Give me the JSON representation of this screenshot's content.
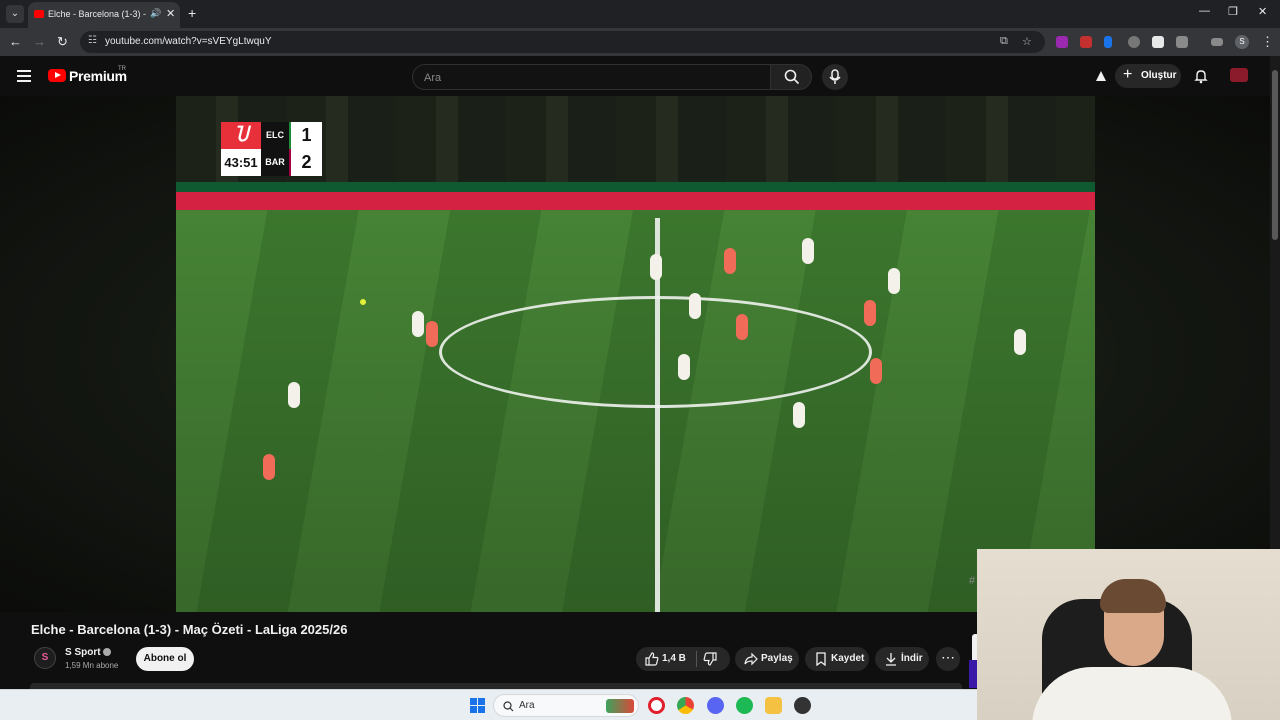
{
  "browser": {
    "tab_title": "Elche - Barcelona (1-3) - Maç Özeti - LaLiga 2025/26",
    "tab_menu_icon": "chevron-down-icon",
    "new_tab": "+",
    "url": "youtube.com/watch?v=sVEYgLtwquY",
    "profile_initial": "S",
    "window_controls": [
      "—",
      "❐",
      "✕"
    ]
  },
  "youtube": {
    "logo_text": "Premium",
    "country_code": "TR",
    "search_placeholder": "Ara",
    "create_label": "Oluştur",
    "brand_color": "#ff0000"
  },
  "scorebug": {
    "clock": "43:51",
    "home_team": "ELC",
    "home_score": "1",
    "away_team": "BAR",
    "away_score": "2",
    "logo_glyph": "Ⴎ"
  },
  "video": {
    "title": "Elche - Barcelona (1-3) - Maç Özeti - LaLiga 2025/26",
    "channel_name": "S Sport",
    "channel_avatar": "S",
    "subscribers": "1,59 Mn abone",
    "subscribe_label": "Abone ol",
    "likes": "1,4 B",
    "share_label": "Paylaş",
    "save_label": "Kaydet",
    "download_label": "İndir",
    "more_label": "⋯",
    "edge_char": "#"
  },
  "taskbar": {
    "search_label": "Ara"
  },
  "pitch_players": {
    "teams": [
      "#f4f1ea",
      "#f06b58"
    ]
  }
}
